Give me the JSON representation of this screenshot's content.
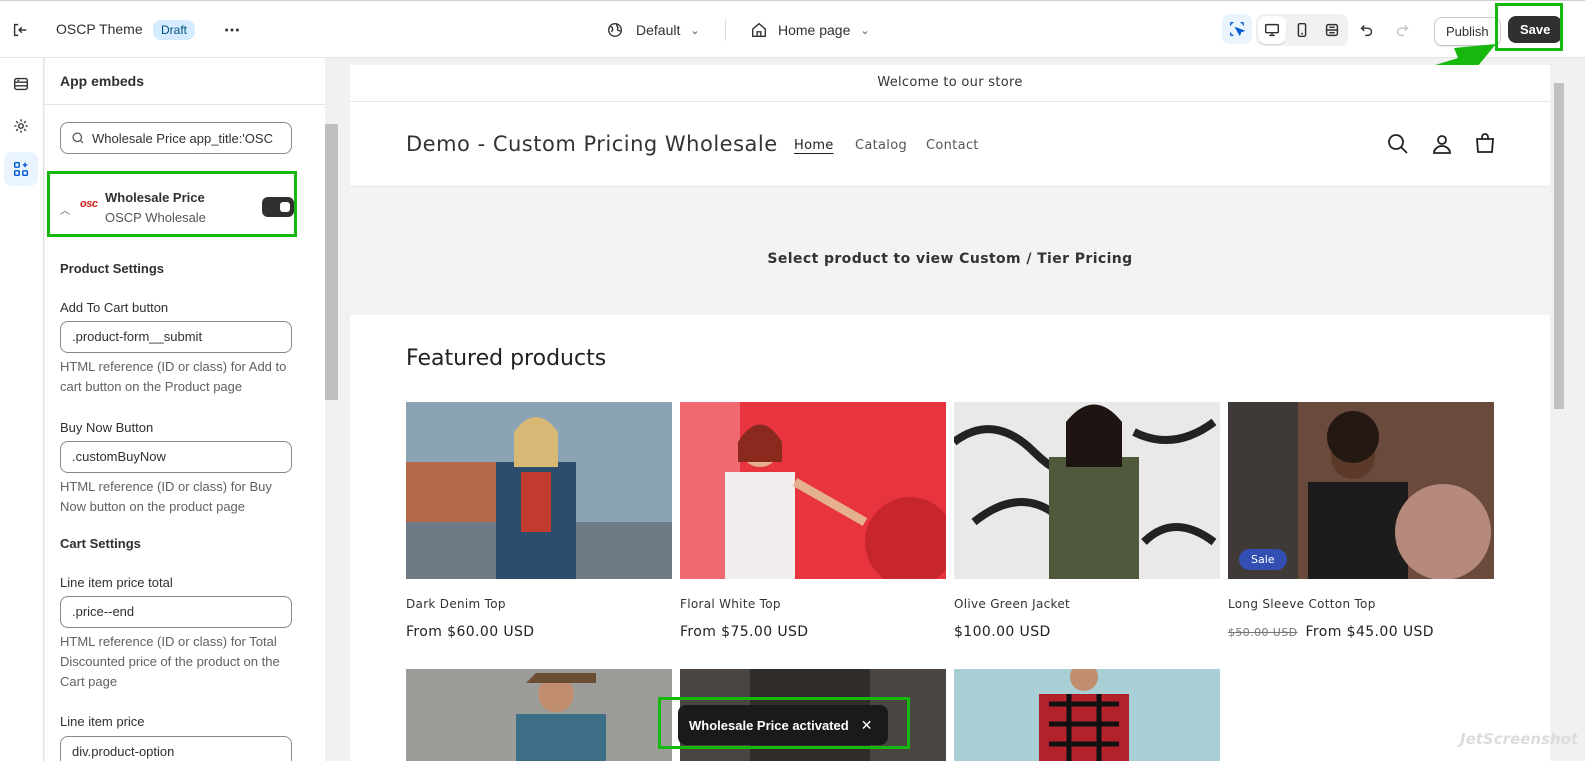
{
  "topbar": {
    "theme_name": "OSCP Theme",
    "draft_label": "Draft",
    "template_label": "Default",
    "page_label": "Home page",
    "publish_label": "Publish",
    "save_label": "Save"
  },
  "panel": {
    "title": "App embeds",
    "search_value": "Wholesale Price app_title:'OSC",
    "embed": {
      "name": "Wholesale Price",
      "provider": "OSCP Wholesale",
      "logo_text": "osc",
      "enabled": true
    },
    "product_settings_title": "Product Settings",
    "cart_settings_title": "Cart Settings",
    "fields": [
      {
        "label": "Add To Cart button",
        "value": ".product-form__submit",
        "help": "HTML reference (ID or class) for Add to cart button on the Product page"
      },
      {
        "label": "Buy Now Button",
        "value": ".customBuyNow",
        "help": "HTML reference (ID or class) for Buy Now button on the product page"
      },
      {
        "label": "Line item price total",
        "value": ".price--end",
        "help": "HTML reference (ID or class) for Total Discounted price of the product on the Cart page"
      },
      {
        "label": "Line item price",
        "value": "div.product-option"
      }
    ]
  },
  "store": {
    "announcement": "Welcome to our store",
    "name": "Demo - Custom Pricing Wholesale",
    "nav": [
      "Home",
      "Catalog",
      "Contact"
    ],
    "banner_text": "Select product to view Custom / Tier Pricing",
    "featured_title": "Featured products",
    "products": [
      {
        "title": "Dark Denim Top",
        "price": "From $60.00 USD"
      },
      {
        "title": "Floral White Top",
        "price": "From $75.00 USD"
      },
      {
        "title": "Olive Green Jacket",
        "price": "$100.00 USD"
      },
      {
        "title": "Long Sleeve Cotton Top",
        "compare_price": "$50.00 USD",
        "price": "From $45.00 USD",
        "badge": "Sale"
      }
    ]
  },
  "toast": {
    "message": "Wholesale Price activated"
  },
  "watermark": "JetScreenshot",
  "colors": {
    "highlight": "#16b80e",
    "sale_badge": "#334fb4",
    "save_button": "#303030",
    "toast": "#1a1a1a"
  }
}
